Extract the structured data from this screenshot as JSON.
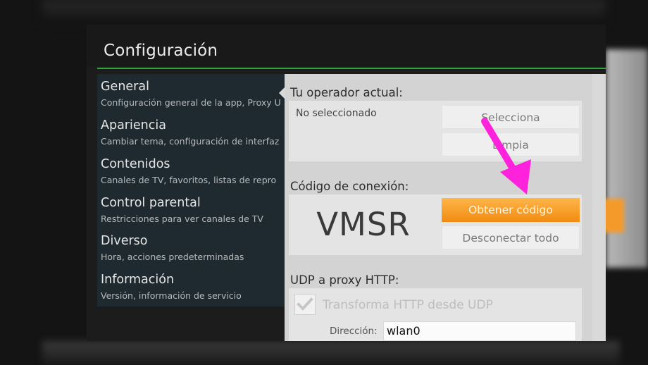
{
  "app": {
    "title": "Configuración"
  },
  "sidebar": {
    "items": [
      {
        "label": "General",
        "description": "Configuración general de la app, Proxy U"
      },
      {
        "label": "Apariencia",
        "description": "Cambiar tema, configuración de interfaz"
      },
      {
        "label": "Contenidos",
        "description": "Canales de TV, favoritos, listas de repro"
      },
      {
        "label": "Control parental",
        "description": "Restricciones para ver canales de TV"
      },
      {
        "label": "Diverso",
        "description": "Hora, acciones predeterminadas"
      },
      {
        "label": "Información",
        "description": "Versión, información de servicio"
      }
    ]
  },
  "operator": {
    "section_title": "Tu operador actual:",
    "current_value": "No seleccionado",
    "select_button": "Selecciona",
    "clear_button": "Limpia"
  },
  "connection": {
    "section_title": "Código de conexión:",
    "code": "VMSR",
    "get_code_button": "Obtener código",
    "disconnect_button": "Desconectar todo"
  },
  "udp_proxy": {
    "section_title": "UDP a proxy HTTP:",
    "transform_label": "Transforma HTTP desde UDP",
    "transform_checked": true,
    "address_label": "Dirección:",
    "address_value": "wlan0"
  },
  "colors": {
    "accent_green": "#2fa53a",
    "primary_orange": "#f49a2a",
    "annotation_arrow": "#ff22dd"
  }
}
